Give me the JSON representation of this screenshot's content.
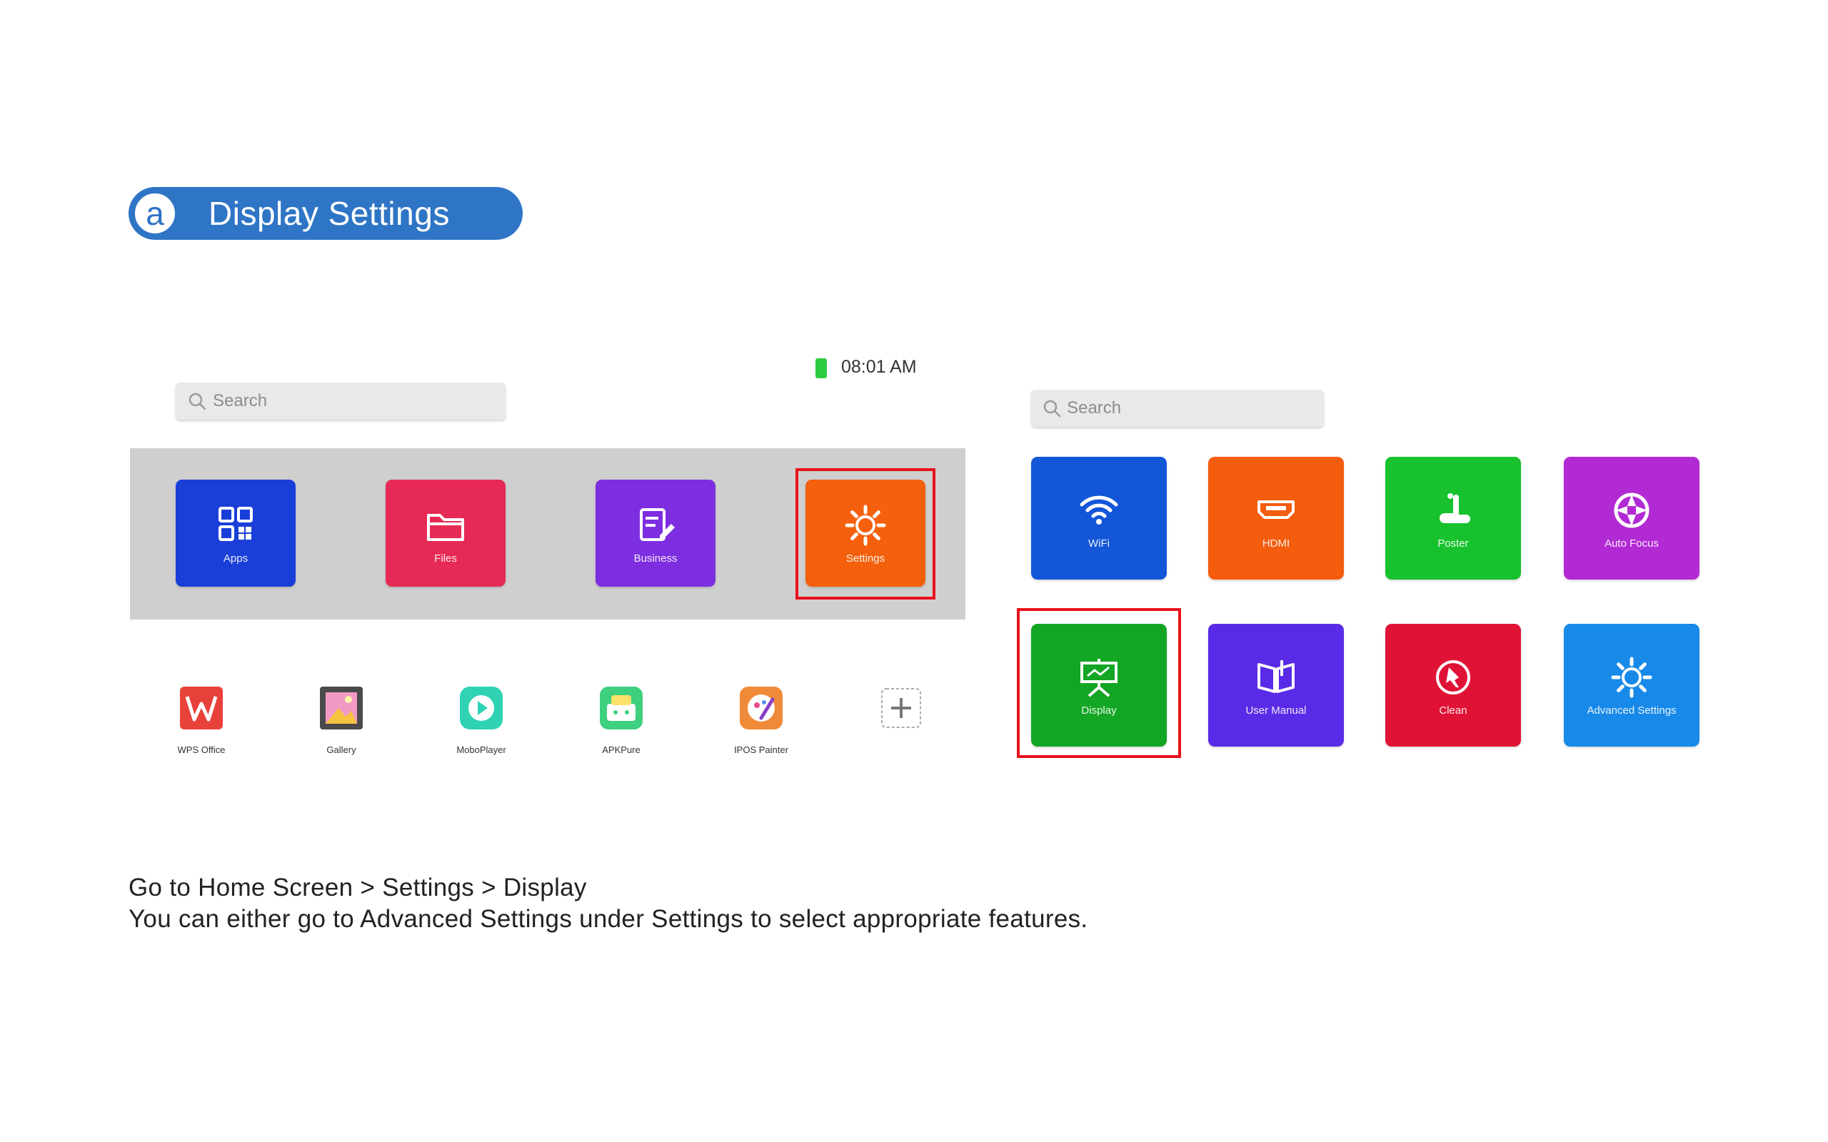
{
  "header": {
    "badge": "a",
    "title": "Display Settings"
  },
  "status": {
    "time": "08:01 AM",
    "battery_color": "#2ccc41"
  },
  "home": {
    "search_placeholder": "Search",
    "dock": [
      {
        "label": "Apps",
        "icon": "apps-grid-icon",
        "color": "#1a3fd8"
      },
      {
        "label": "Files",
        "icon": "folder-icon",
        "color": "#e62a55"
      },
      {
        "label": "Business",
        "icon": "document-edit-icon",
        "color": "#7d2ee0"
      },
      {
        "label": "Settings",
        "icon": "gear-icon",
        "color": "#f4600c",
        "highlighted": true
      }
    ],
    "apps": [
      {
        "label": "WPS Office",
        "icon": "wps-office-icon"
      },
      {
        "label": "Gallery",
        "icon": "gallery-icon"
      },
      {
        "label": "MoboPlayer",
        "icon": "play-icon"
      },
      {
        "label": "APKPure",
        "icon": "apkpure-icon"
      },
      {
        "label": "IPOS Painter",
        "icon": "painter-icon"
      },
      {
        "label": "",
        "icon": "add-icon"
      }
    ]
  },
  "settings": {
    "search_placeholder": "Search",
    "tiles": [
      {
        "label": "WiFi",
        "icon": "wifi-icon",
        "color": "#1356d8"
      },
      {
        "label": "HDMI",
        "icon": "hdmi-icon",
        "color": "#f45c0e"
      },
      {
        "label": "Poster",
        "icon": "poster-icon",
        "color": "#18c22e"
      },
      {
        "label": "Auto Focus",
        "icon": "aperture-icon",
        "color": "#b22ad4"
      },
      {
        "label": "Display",
        "icon": "projector-screen-icon",
        "color": "#13a524",
        "highlighted": true
      },
      {
        "label": "User Manual",
        "icon": "book-icon",
        "color": "#5a2be6"
      },
      {
        "label": "Clean",
        "icon": "clean-icon",
        "color": "#e01337"
      },
      {
        "label": "Advanced Settings",
        "icon": "gear-icon",
        "color": "#1789e8"
      }
    ]
  },
  "highlight_color": "#e8121d",
  "instructions": {
    "line1": "Go to Home Screen > Settings > Display",
    "line2": "You can either go to Advanced Settings under Settings to select appropriate features."
  }
}
